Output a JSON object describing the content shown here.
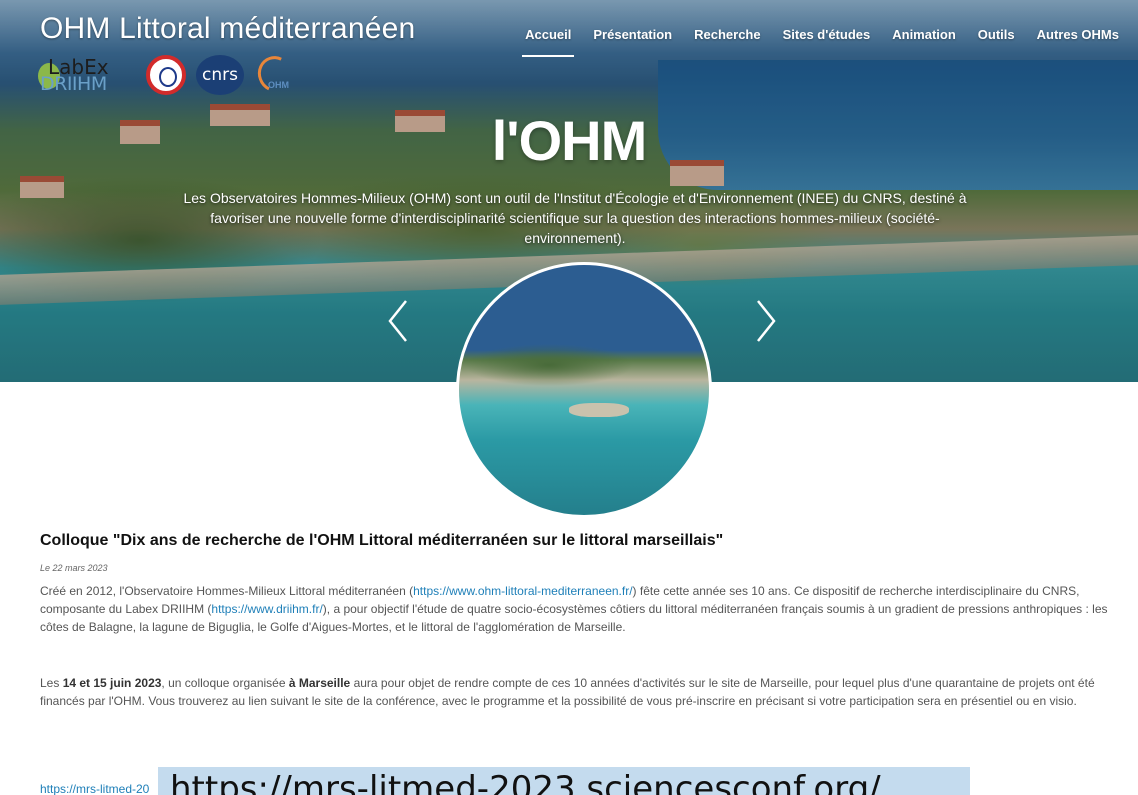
{
  "site": {
    "title": "OHM Littoral méditerranéen",
    "logos": {
      "labex_line1": "LabEx",
      "labex_line2": "DRIIHM",
      "cnrs": "cnrs",
      "ohm": "OHM"
    }
  },
  "nav": {
    "items": [
      {
        "label": "Accueil",
        "active": true
      },
      {
        "label": "Présentation"
      },
      {
        "label": "Recherche"
      },
      {
        "label": "Sites d'études"
      },
      {
        "label": "Animation"
      },
      {
        "label": "Outils"
      },
      {
        "label": "Autres OHMs"
      }
    ]
  },
  "hero": {
    "heading": "l'OHM",
    "description": "Les Observatoires Hommes-Milieux (OHM) sont un outil de l'Institut d'Écologie et d'Environnement (INEE) du CNRS, destiné à favoriser une nouvelle forme d'interdisciplinarité scientifique sur la question des interactions hommes-milieux (société-environnement).",
    "icons": {
      "prev": "chevron-left-icon",
      "next": "chevron-right-icon"
    }
  },
  "article": {
    "title": "Colloque \"Dix ans de recherche de l'OHM Littoral méditerranéen sur le littoral marseillais\"",
    "date": "Le 22 mars 2023",
    "p1_before": "Créé en 2012, l'Observatoire Hommes-Milieux Littoral méditerranéen (",
    "p1_link1": "https://www.ohm-littoral-mediterraneen.fr/",
    "p1_middle": ") fête cette année ses 10 ans. Ce dispositif de recherche interdisciplinaire du CNRS, composante du Labex DRIIHM (",
    "p1_link2": "https://www.driihm.fr/",
    "p1_after": "), a pour objectif l'étude de quatre socio-écosystèmes côtiers du littoral méditerranéen français soumis à un gradient de pressions anthropiques : les côtes de Balagne, la lagune de Biguglia, le Golfe d'Aigues-Mortes, et le littoral de l'agglomération de Marseille.",
    "p2_a": "Les ",
    "p2_dates": "14 et 15 juin 2023",
    "p2_b": ", un colloque organisée ",
    "p2_place": "à Marseille",
    "p2_c": " aura pour objet de rendre compte de ces 10 années d'activités sur le site de Marseille, pour lequel plus d'une quarantaine de projets ont été financés par l'OHM. Vous trouverez au lien suivant le site de la conférence, avec le programme et la possibilité de vous pré-inscrire en précisant si votre participation sera en présentiel ou en visio.",
    "link_partial": "https://mrs-litmed-20",
    "overlay_text": "https://mrs-litmed-2023.sciencesconf.org/"
  },
  "colors": {
    "link": "#1e7fb8",
    "overlay": "#c4dbee",
    "title": "#111111"
  }
}
